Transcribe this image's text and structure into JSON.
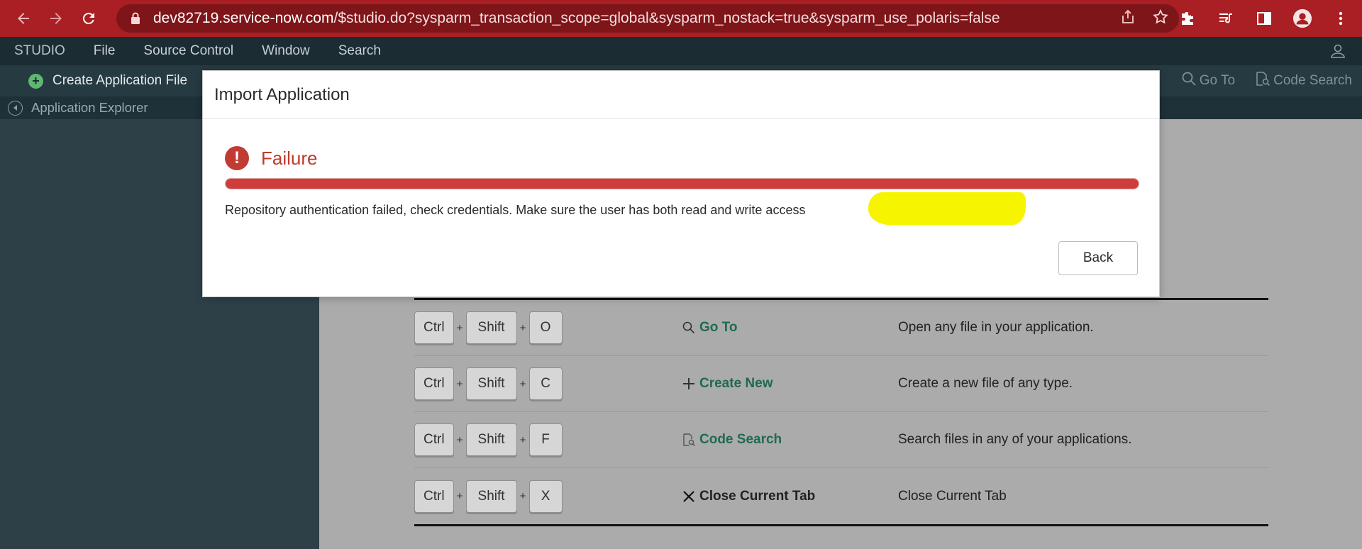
{
  "browser": {
    "url_host": "dev82719.service-now.com",
    "url_path": "/$studio.do?sysparm_transaction_scope=global&sysparm_nostack=true&sysparm_use_polaris=false",
    "icons": [
      "back-arrow-icon",
      "forward-arrow-icon",
      "reload-icon",
      "lock-icon",
      "share-icon",
      "star-icon",
      "extensions-icon",
      "media-icon",
      "side-panel-icon",
      "profile-icon",
      "more-vert-icon"
    ],
    "accent_color": "#a91f23"
  },
  "menubar": {
    "brand": "STUDIO",
    "items": [
      "File",
      "Source Control",
      "Window",
      "Search"
    ]
  },
  "toolbar": {
    "create_label": "Create Application File",
    "goto_label": "Go To",
    "code_search_label": "Code Search"
  },
  "explorer": {
    "label": "Application Explorer"
  },
  "shortcuts": {
    "rows": [
      {
        "keys": [
          "Ctrl",
          "Shift",
          "O"
        ],
        "action": "Go To",
        "description": "Open any file in your application."
      },
      {
        "keys": [
          "Ctrl",
          "Shift",
          "C"
        ],
        "action": "Create New",
        "description": "Create a new file of any type."
      },
      {
        "keys": [
          "Ctrl",
          "Shift",
          "F"
        ],
        "action": "Code Search",
        "description": "Search files in any of your applications."
      },
      {
        "keys": [
          "Ctrl",
          "Shift",
          "X"
        ],
        "action": "Close Current Tab",
        "description": "Close Current Tab"
      }
    ],
    "plus": "+"
  },
  "modal": {
    "title": "Import Application",
    "status_title": "Failure",
    "status_color": "#c0392b",
    "progress_fraction": 1.0,
    "message_plain": "Repository authentication failed, check credentials. Make sure the user has b",
    "message_highlighted": "oth read and write access",
    "highlight_color": "#f7f400",
    "back_label": "Back"
  }
}
